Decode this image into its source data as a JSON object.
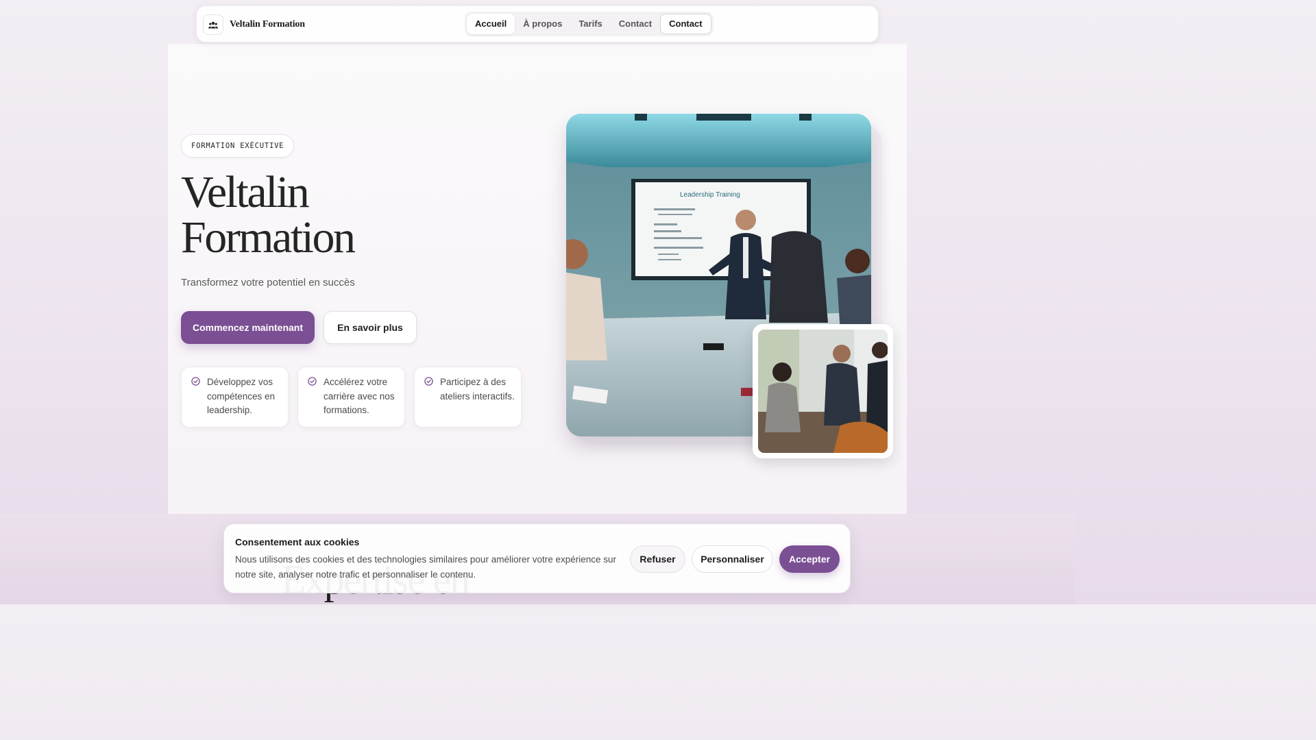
{
  "nav": {
    "brand": "Veltalin Formation",
    "links": [
      {
        "label": "Accueil"
      },
      {
        "label": "À propos"
      },
      {
        "label": "Tarifs"
      },
      {
        "label": "Contact"
      }
    ],
    "cta_label": "Contact"
  },
  "hero": {
    "badge": "FORMATION EXÉCUTIVE",
    "title_line1": "Veltalin",
    "title_line2": "Formation",
    "subtitle": "Transformez votre potentiel en succès",
    "primary_button": "Commencez maintenant",
    "secondary_button": "En savoir plus",
    "features": [
      {
        "text": "Développez vos compétences en leadership."
      },
      {
        "text": "Accélérez votre carrière avec nos formations."
      },
      {
        "text": "Participez à des ateliers interactifs."
      }
    ],
    "photo_screen_text": "Leadership Training"
  },
  "next_section_heading": "Expertise en",
  "cookie": {
    "title": "Consentement aux cookies",
    "text": "Nous utilisons des cookies et des technologies similaires pour améliorer votre expérience sur notre site, analyser notre trafic et personnaliser le contenu.",
    "refuse": "Refuser",
    "customize": "Personnaliser",
    "accept": "Accepter"
  },
  "colors": {
    "accent": "#7b4f93",
    "background": "#f3eef4"
  },
  "icons": {
    "brand": "users-icon",
    "feature": "check-circle-icon"
  }
}
